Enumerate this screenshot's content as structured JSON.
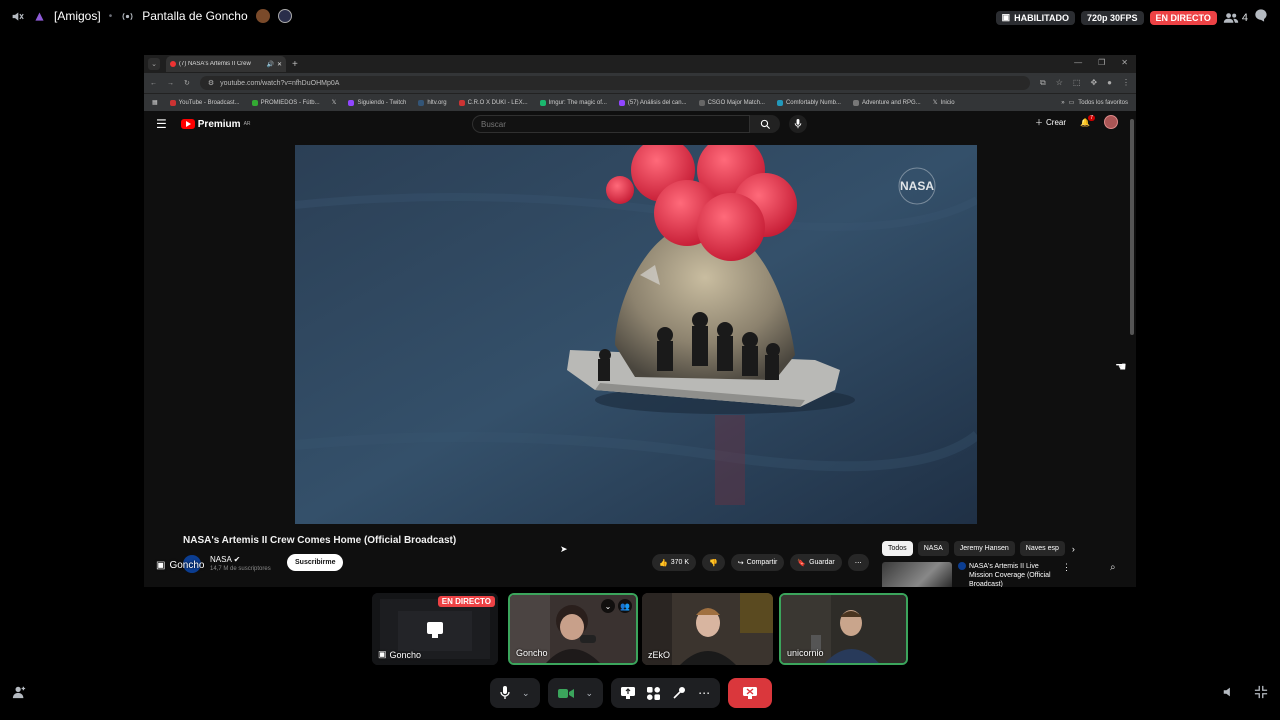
{
  "topbar": {
    "channel": "[Amigos]",
    "stream_title": "Pantalla de Goncho",
    "enabled_badge": "HABILITADO",
    "quality_badge": "720p 30FPS",
    "live_badge": "EN DIRECTO",
    "viewer_count": "4"
  },
  "browser": {
    "tab_title": "(7) NASA's Artemis II Crew",
    "url": "youtube.com/watch?v=nfhDuOHMp0A",
    "bookmarks": [
      "YouTube - Broadcast...",
      "PROMIEDOS - Fútb...",
      "Siguiendo - Twitch",
      "hltv.org",
      "C.R.O X DUKI - LEX...",
      "Imgur: The magic of...",
      "(57) Análisis del can...",
      "CSGO Major Match...",
      "Comfortably Numb...",
      "Adventure and RPG...",
      "Inicio"
    ],
    "all_bookmarks": "Todos los favoritos"
  },
  "youtube": {
    "logo_text": "Premium",
    "logo_sup": "AR",
    "search_placeholder": "Buscar",
    "create_label": "Crear",
    "notif_count": "7",
    "video_title": "NASA's Artemis II Crew Comes Home (Official Broadcast)",
    "channel_name": "NASA",
    "subscribers": "14,7 M de suscriptores",
    "subscribe_label": "Suscribirme",
    "like_count": "370 K",
    "share_label": "Compartir",
    "save_label": "Guardar",
    "chips": [
      "Todos",
      "NASA",
      "Jeremy Hansen",
      "Naves esp"
    ],
    "rec_title": "NASA's Artemis II Live Mission Coverage (Official Broadcast)",
    "video_watermark": "NASA"
  },
  "stream_overlay_name": "Goncho",
  "participants": [
    {
      "name": "Goncho",
      "live": "EN DIRECTO"
    },
    {
      "name": "Goncho"
    },
    {
      "name": "zEkO"
    },
    {
      "name": "unicornio"
    }
  ],
  "colors": {
    "live_red": "#ed4245",
    "speaking_green": "#3ba55c",
    "hangup_red": "#da373c",
    "youtube_red": "#ff0000"
  }
}
